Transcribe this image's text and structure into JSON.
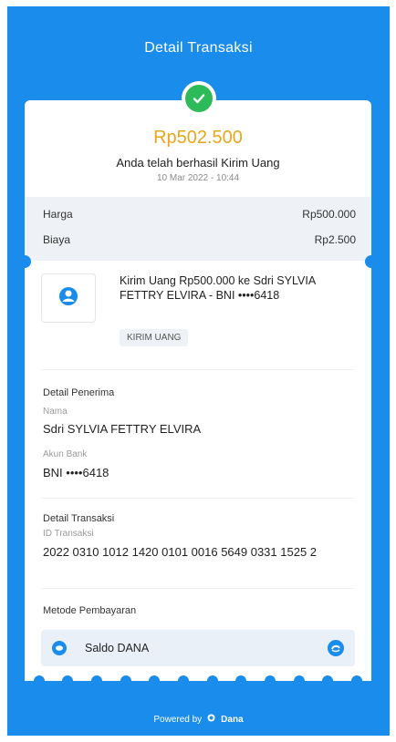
{
  "header": {
    "title": "Detail Transaksi"
  },
  "summary": {
    "amount": "Rp502.500",
    "status": "Anda telah berhasil Kirim Uang",
    "datetime": "10 Mar 2022 - 10:44"
  },
  "fees": [
    {
      "label": "Harga",
      "value": "Rp500.000"
    },
    {
      "label": "Biaya",
      "value": "Rp2.500"
    }
  ],
  "product": {
    "icon": "user-transfer-icon",
    "description": "Kirim Uang Rp500.000 ke Sdri SYLVIA FETTRY ELVIRA - BNI ••••6418",
    "chip": "KIRIM UANG"
  },
  "recipient": {
    "section_title": "Detail Penerima",
    "name_label": "Nama",
    "name_value": "Sdri SYLVIA FETTRY ELVIRA",
    "account_label": "Akun Bank",
    "account_value": "BNI ••••6418"
  },
  "transaction": {
    "section_title": "Detail Transaksi",
    "id_label": "ID Transaksi",
    "id_value": "2022 0310 1012 1420 0101 0016 5649 0331 1525 2"
  },
  "payment": {
    "section_title": "Metode Pembayaran",
    "method": "Saldo DANA"
  },
  "footer": {
    "powered_by": "Powered by",
    "brand": "Dana"
  },
  "colors": {
    "primary": "#1a8ceb",
    "amount": "#e8a61d",
    "success": "#2dbb5a"
  }
}
